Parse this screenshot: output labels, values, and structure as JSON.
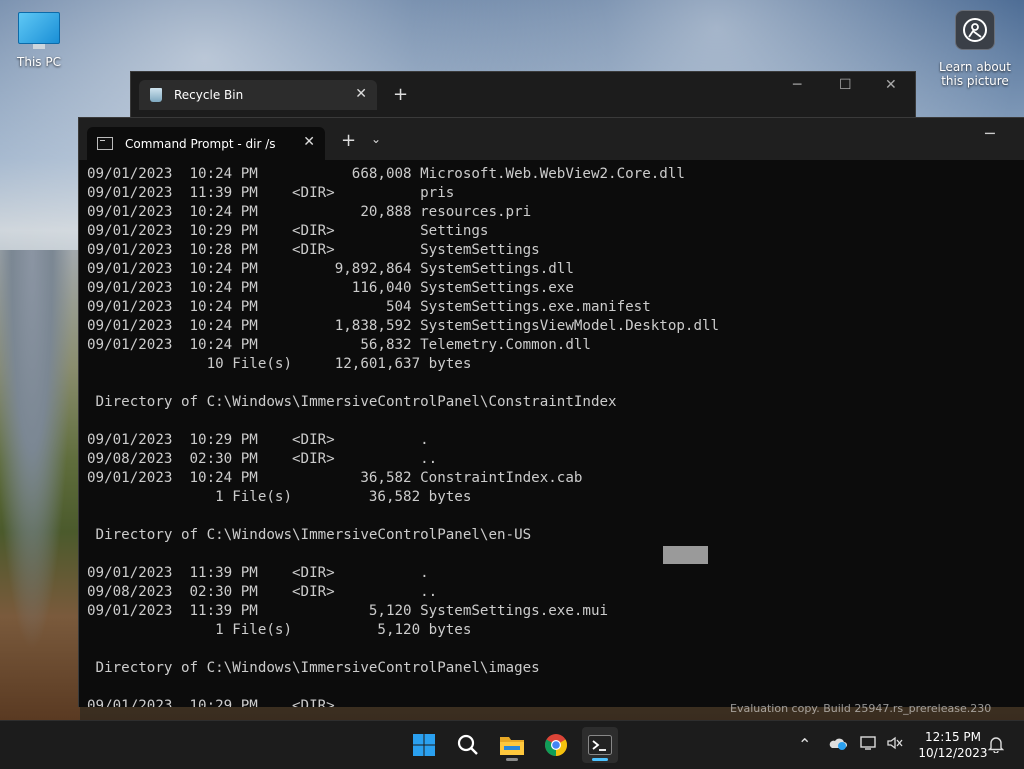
{
  "desktop": {
    "icons": [
      {
        "label": "This PC"
      },
      {
        "label": "Learn about this picture"
      }
    ],
    "watermark": "Evaluation copy. Build 25947.rs_prerelease.230"
  },
  "recycle_window": {
    "tab_title": "Recycle Bin",
    "new_tab": "+",
    "close": "✕",
    "minimize": "─",
    "maximize": "☐",
    "window_close": "✕"
  },
  "cmd_window": {
    "tab_title": "Command Prompt - dir  /s",
    "new_tab": "+",
    "dropdown": "⌄",
    "close": "✕",
    "minimize": "─",
    "lines": [
      "09/01/2023  10:24 PM           668,008 Microsoft.Web.WebView2.Core.dll",
      "09/01/2023  11:39 PM    <DIR>          pris",
      "09/01/2023  10:24 PM            20,888 resources.pri",
      "09/01/2023  10:29 PM    <DIR>          Settings",
      "09/01/2023  10:28 PM    <DIR>          SystemSettings",
      "09/01/2023  10:24 PM         9,892,864 SystemSettings.dll",
      "09/01/2023  10:24 PM           116,040 SystemSettings.exe",
      "09/01/2023  10:24 PM               504 SystemSettings.exe.manifest",
      "09/01/2023  10:24 PM         1,838,592 SystemSettingsViewModel.Desktop.dll",
      "09/01/2023  10:24 PM            56,832 Telemetry.Common.dll",
      "              10 File(s)     12,601,637 bytes",
      "",
      " Directory of C:\\Windows\\ImmersiveControlPanel\\ConstraintIndex",
      "",
      "09/01/2023  10:29 PM    <DIR>          .",
      "09/08/2023  02:30 PM    <DIR>          ..",
      "09/01/2023  10:24 PM            36,582 ConstraintIndex.cab",
      "               1 File(s)         36,582 bytes",
      "",
      " Directory of C:\\Windows\\ImmersiveControlPanel\\en-US",
      "",
      "09/01/2023  11:39 PM    <DIR>          .",
      "09/08/2023  02:30 PM    <DIR>          ..",
      "09/01/2023  11:39 PM             5,120 SystemSettings.exe.mui",
      "               1 File(s)          5,120 bytes",
      "",
      " Directory of C:\\Windows\\ImmersiveControlPanel\\images",
      "",
      "09/01/2023  10:29 PM    <DIR>          ."
    ]
  },
  "taskbar": {
    "apps": [
      {
        "name": "start",
        "icon": "windows-logo-icon"
      },
      {
        "name": "search",
        "icon": "search-icon"
      },
      {
        "name": "file-explorer",
        "icon": "folder-icon"
      },
      {
        "name": "chrome",
        "icon": "chrome-icon"
      },
      {
        "name": "terminal",
        "icon": "terminal-icon"
      }
    ],
    "tray": {
      "chevron": "⌃",
      "time": "12:15 PM",
      "date": "10/12/2023"
    }
  },
  "colors": {
    "accent": "#4cc2ff",
    "console_bg": "#0c0c0c",
    "console_fg": "#cccccc",
    "taskbar_bg": "#1c1c1c"
  }
}
